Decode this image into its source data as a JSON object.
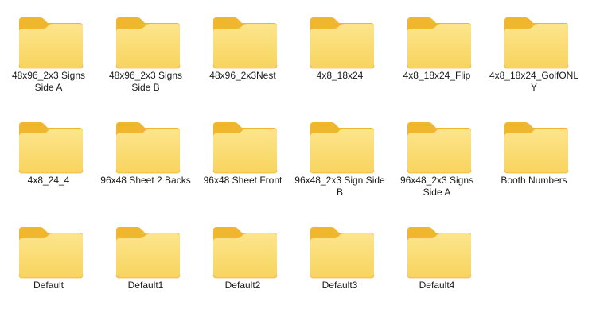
{
  "colors": {
    "folder_back": "#f0b62d",
    "folder_front_top": "#fde58d",
    "folder_front_bottom": "#f8d45e",
    "folder_edge": "#e8a91c",
    "background": "#ffffff",
    "label_text": "#1a1a1a"
  },
  "folders": [
    {
      "name": "48x96_2x3 Signs Side A",
      "icon": "folder-icon"
    },
    {
      "name": "48x96_2x3 Signs Side B",
      "icon": "folder-icon"
    },
    {
      "name": "48x96_2x3Nest",
      "icon": "folder-icon"
    },
    {
      "name": "4x8_18x24",
      "icon": "folder-icon"
    },
    {
      "name": "4x8_18x24_Flip",
      "icon": "folder-icon"
    },
    {
      "name": "4x8_18x24_GolfONLY",
      "icon": "folder-icon"
    },
    {
      "name": "4x8_24_4",
      "icon": "folder-icon"
    },
    {
      "name": "96x48 Sheet 2 Backs",
      "icon": "folder-icon"
    },
    {
      "name": "96x48 Sheet Front",
      "icon": "folder-icon"
    },
    {
      "name": "96x48_2x3 Sign Side B",
      "icon": "folder-icon"
    },
    {
      "name": "96x48_2x3 Signs Side A",
      "icon": "folder-icon"
    },
    {
      "name": "Booth Numbers",
      "icon": "folder-icon"
    },
    {
      "name": "Default",
      "icon": "folder-icon"
    },
    {
      "name": "Default1",
      "icon": "folder-icon"
    },
    {
      "name": "Default2",
      "icon": "folder-icon"
    },
    {
      "name": "Default3",
      "icon": "folder-icon"
    },
    {
      "name": "Default4",
      "icon": "folder-icon"
    }
  ]
}
